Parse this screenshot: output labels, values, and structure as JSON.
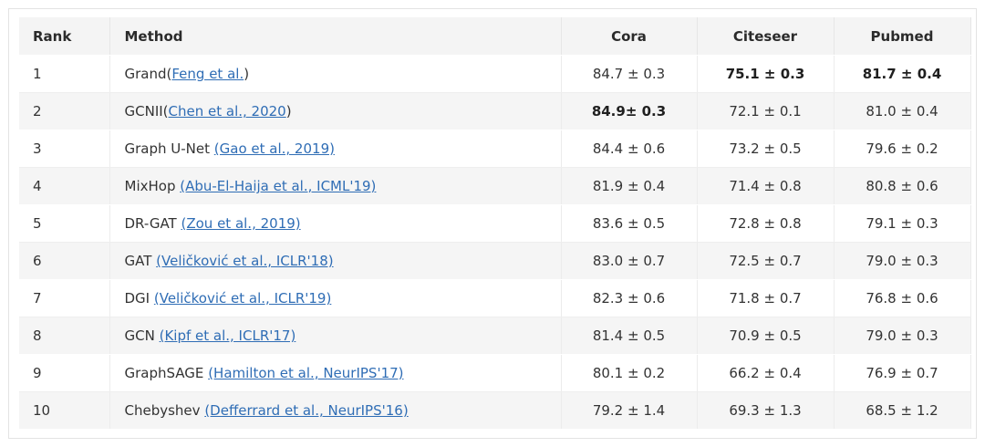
{
  "table": {
    "headers": {
      "rank": "Rank",
      "method": "Method",
      "cora": "Cora",
      "citeseer": "Citeseer",
      "pubmed": "Pubmed"
    },
    "rows": [
      {
        "rank": "1",
        "method_name": "Grand(",
        "citation": "Feng et al.",
        "method_suffix": ")",
        "cora": "84.7 ± 0.3",
        "citeseer": "75.1 ± 0.3",
        "pubmed": "81.7 ± 0.4",
        "bold": [
          "citeseer",
          "pubmed"
        ]
      },
      {
        "rank": "2",
        "method_name": "GCNII(",
        "citation": "Chen et al., 2020",
        "method_suffix": ")",
        "cora": "84.9± 0.3",
        "citeseer": "72.1 ± 0.1",
        "pubmed": "81.0 ± 0.4",
        "bold": [
          "cora"
        ]
      },
      {
        "rank": "3",
        "method_name": "Graph U-Net ",
        "citation": "(Gao et al., 2019)",
        "method_suffix": "",
        "cora": "84.4 ± 0.6",
        "citeseer": "73.2 ± 0.5",
        "pubmed": "79.6 ± 0.2",
        "bold": []
      },
      {
        "rank": "4",
        "method_name": "MixHop ",
        "citation": "(Abu-El-Haija et al., ICML'19)",
        "method_suffix": "",
        "cora": "81.9 ± 0.4",
        "citeseer": "71.4 ± 0.8",
        "pubmed": "80.8 ± 0.6",
        "bold": []
      },
      {
        "rank": "5",
        "method_name": "DR-GAT ",
        "citation": "(Zou et al., 2019)",
        "method_suffix": "",
        "cora": "83.6 ± 0.5",
        "citeseer": "72.8 ± 0.8",
        "pubmed": "79.1 ± 0.3",
        "bold": []
      },
      {
        "rank": "6",
        "method_name": "GAT ",
        "citation": "(Veličković et al., ICLR'18)",
        "method_suffix": "",
        "cora": "83.0 ± 0.7",
        "citeseer": "72.5 ± 0.7",
        "pubmed": "79.0 ± 0.3",
        "bold": []
      },
      {
        "rank": "7",
        "method_name": "DGI ",
        "citation": "(Veličković et al., ICLR'19)",
        "method_suffix": "",
        "cora": "82.3 ± 0.6",
        "citeseer": "71.8 ± 0.7",
        "pubmed": "76.8 ± 0.6",
        "bold": []
      },
      {
        "rank": "8",
        "method_name": "GCN ",
        "citation": "(Kipf et al., ICLR'17)",
        "method_suffix": "",
        "cora": "81.4 ± 0.5",
        "citeseer": "70.9 ± 0.5",
        "pubmed": "79.0 ± 0.3",
        "bold": []
      },
      {
        "rank": "9",
        "method_name": "GraphSAGE ",
        "citation": "(Hamilton et al., NeurIPS'17)",
        "method_suffix": "",
        "cora": "80.1 ± 0.2",
        "citeseer": "66.2 ± 0.4",
        "pubmed": "76.9 ± 0.7",
        "bold": []
      },
      {
        "rank": "10",
        "method_name": "Chebyshev ",
        "citation": "(Defferrard et al., NeurIPS'16)",
        "method_suffix": "",
        "cora": "79.2 ± 1.4",
        "citeseer": "69.3 ± 1.3",
        "pubmed": "68.5 ± 1.2",
        "bold": []
      }
    ]
  },
  "colors": {
    "link": "#2f6db5",
    "header_bg": "#f4f4f4",
    "stripe_bg": "#f5f5f5"
  }
}
